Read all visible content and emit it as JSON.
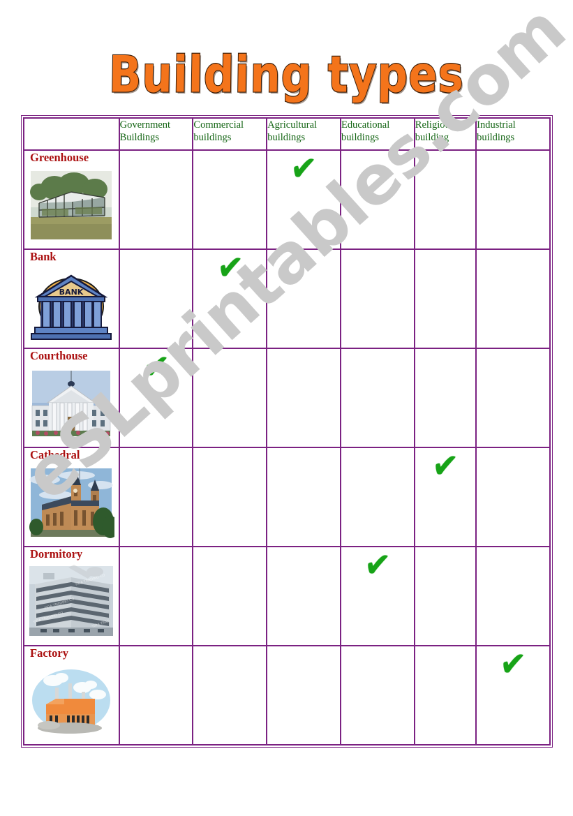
{
  "title": "Building types",
  "watermark": "eSLprintables.com",
  "table": {
    "corner_label": "",
    "columns": [
      "Government Buildings",
      "Commercial buildings",
      "Agricultural buildings",
      "Educational buildings",
      "Religious building",
      "Industrial buildings"
    ],
    "check_mark": "✔",
    "rows": [
      {
        "label": "Greenhouse",
        "image": "greenhouse-photo",
        "marks": [
          false,
          false,
          true,
          false,
          false,
          false
        ]
      },
      {
        "label": "Bank",
        "image": "bank-clipart",
        "marks": [
          false,
          true,
          false,
          false,
          false,
          false
        ]
      },
      {
        "label": "Courthouse",
        "image": "courthouse-photo",
        "marks": [
          true,
          false,
          false,
          false,
          false,
          false
        ]
      },
      {
        "label": "Cathedral",
        "image": "cathedral-photo",
        "marks": [
          false,
          false,
          false,
          false,
          true,
          false
        ]
      },
      {
        "label": "Dormitory",
        "image": "dormitory-photo",
        "marks": [
          false,
          false,
          false,
          true,
          false,
          false
        ]
      },
      {
        "label": "Factory",
        "image": "factory-clipart",
        "marks": [
          false,
          false,
          false,
          false,
          false,
          true
        ]
      }
    ]
  },
  "colors": {
    "title_fill": "#F4741B",
    "title_outline": "#3A1D08",
    "border": "#7B2182",
    "header_text": "#136413",
    "row_label_text": "#AB1111",
    "check": "#17A317",
    "watermark": "#C9C9C9"
  },
  "image_labels": {
    "bank_sign": "BANK"
  }
}
